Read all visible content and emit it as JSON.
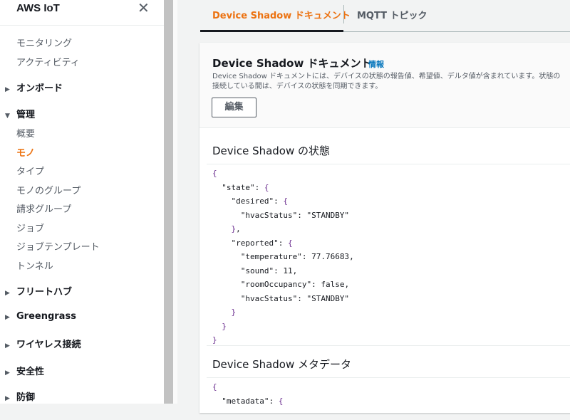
{
  "sidebar": {
    "title": "AWS IoT",
    "close": "✕",
    "items": [
      "モニタリング",
      "アクティビティ"
    ],
    "sections": {
      "onboard": "オンボード",
      "manage": "管理",
      "fleethub": "フリートハブ",
      "greengrass": "Greengrass",
      "wireless": "ワイヤレス接続",
      "security": "安全性",
      "defend": "防御"
    },
    "manage_items": [
      "概要",
      "モノ",
      "タイプ",
      "モノのグループ",
      "請求グループ",
      "ジョブ",
      "ジョブテンプレート",
      "トンネル"
    ]
  },
  "tabs": [
    "Device Shadow ドキュメント",
    "MQTT トピック"
  ],
  "panel": {
    "title": "Device Shadow ドキュメント",
    "info": "情報",
    "desc1": "Device Shadow ドキュメントには、デバイスの状態の報告値、希望値、デルタ値が含まれています。状態の",
    "desc2": "接続している間は、デバイスの状態を同期できます。",
    "edit": "編集",
    "state_title": "Device Shadow の状態",
    "meta_title": "Device Shadow メタデータ"
  },
  "state_json": {
    "hvac_desired": "\"STANDBY\"",
    "temperature": "77.76683",
    "sound": "11",
    "roomOccupancy": "false",
    "hvac_reported": "\"STANDBY\""
  }
}
